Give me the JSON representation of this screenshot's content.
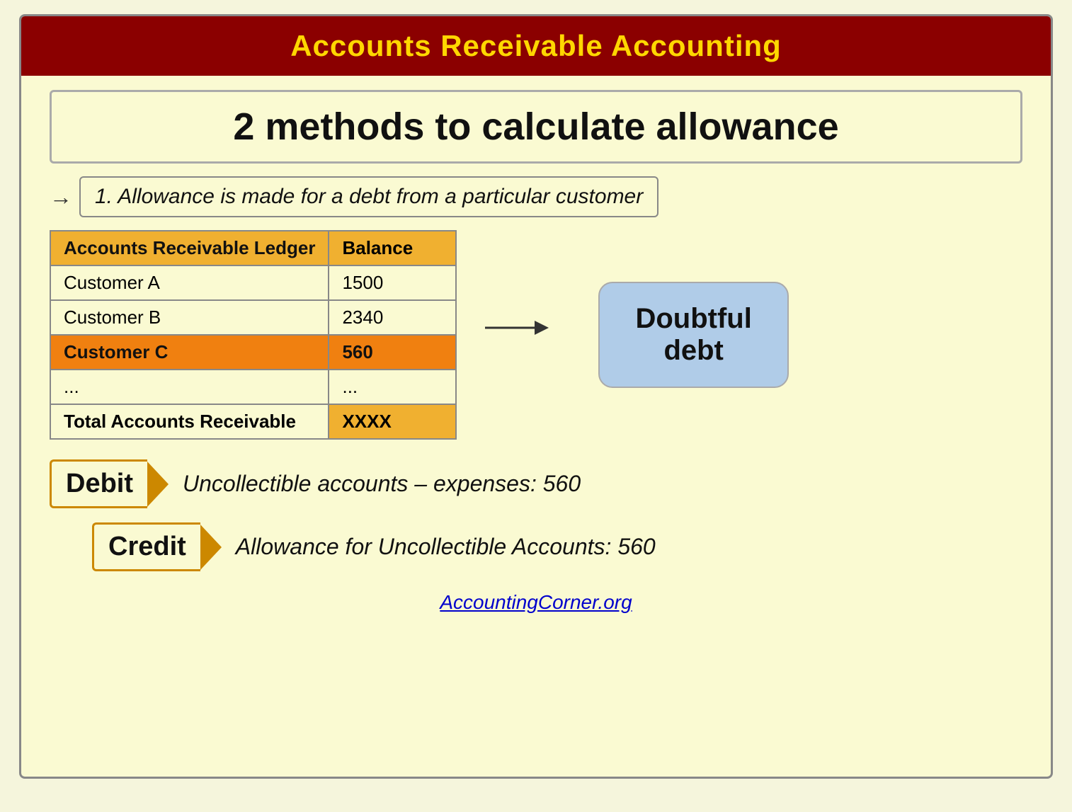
{
  "header": {
    "title": "Accounts Receivable Accounting",
    "background": "#8b0000",
    "color": "#ffd700"
  },
  "methods_box": {
    "title": "2 methods to calculate allowance"
  },
  "method1": {
    "label": "1. Allowance is made for a debt from a particular customer"
  },
  "ledger": {
    "header1": "Accounts Receivable Ledger",
    "header2": "Balance",
    "rows": [
      {
        "name": "Customer A",
        "value": "1500"
      },
      {
        "name": "Customer B",
        "value": "2340"
      },
      {
        "name": "Customer C",
        "value": "560"
      },
      {
        "name": "...",
        "value": "..."
      },
      {
        "name": "Total Accounts Receivable",
        "value": "XXXX"
      }
    ]
  },
  "doubtful": {
    "line1": "Doubtful",
    "line2": "debt"
  },
  "debit": {
    "label": "Debit",
    "text": "Uncollectible accounts – expenses: 560"
  },
  "credit": {
    "label": "Credit",
    "text": "Allowance for Uncollectible Accounts: 560"
  },
  "footer": {
    "link_text": "AccountingCorner.org",
    "link_url": "http://AccountingCorner.org"
  }
}
